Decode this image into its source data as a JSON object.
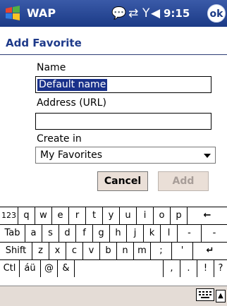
{
  "titlebar": {
    "title": "WAP",
    "time": "9:15",
    "ok_label": "ok",
    "icons": [
      "windows-start-icon",
      "messaging-icon",
      "connectivity-icon",
      "signal-icon",
      "volume-icon"
    ]
  },
  "form": {
    "title": "Add Favorite",
    "name_label": "Name",
    "name_value": "Default name",
    "address_label": "Address (URL)",
    "address_value": "",
    "create_in_label": "Create in",
    "create_in_value": "My Favorites",
    "cancel_label": "Cancel",
    "add_label": "Add"
  },
  "keyboard": {
    "rows": [
      [
        "123",
        "q",
        "w",
        "e",
        "r",
        "t",
        "y",
        "u",
        "i",
        "o",
        "p",
        "←"
      ],
      [
        "Tab",
        "a",
        "s",
        "d",
        "f",
        "g",
        "h",
        "j",
        "k",
        "l",
        "-",
        "-"
      ],
      [
        "Shift",
        "z",
        "x",
        "c",
        "v",
        "b",
        "n",
        "m",
        ";",
        "'",
        "↵"
      ],
      [
        "Ctl",
        "áü",
        "@",
        "&",
        "",
        ",",
        ".",
        "!",
        "?"
      ]
    ]
  },
  "colors": {
    "titlebar": "#1b3a86",
    "accent_text": "#1e3a8a",
    "selection": "#19318a",
    "button_face": "#eadfd7"
  }
}
